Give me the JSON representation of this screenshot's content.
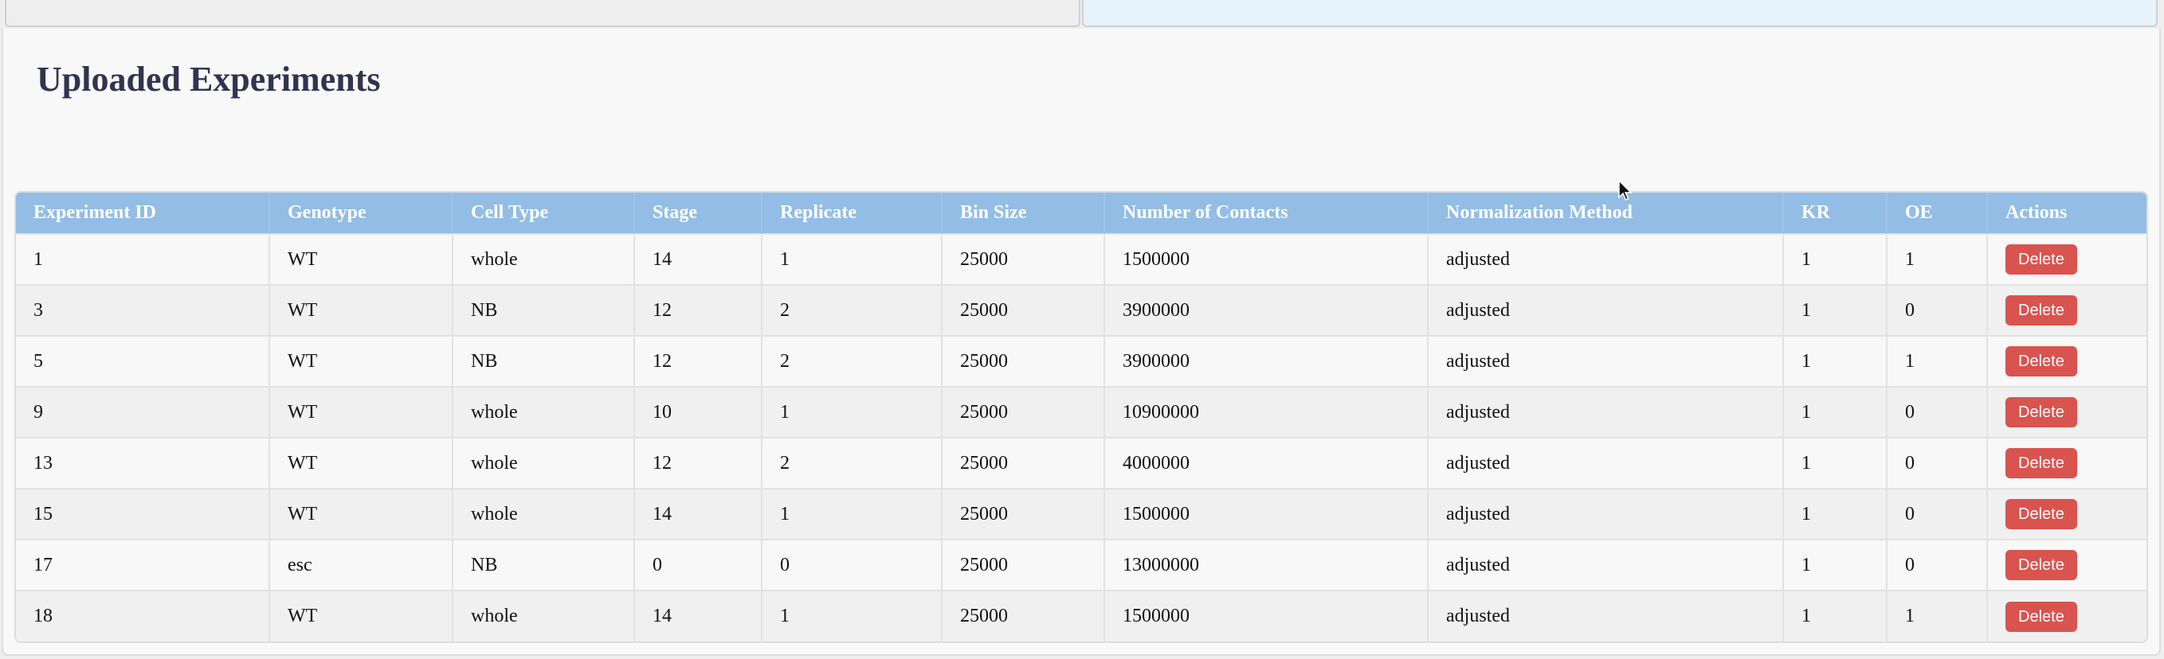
{
  "page": {
    "title": "Uploaded Experiments"
  },
  "table": {
    "headers": [
      "Experiment ID",
      "Genotype",
      "Cell Type",
      "Stage",
      "Replicate",
      "Bin Size",
      "Number of Contacts",
      "Normalization Method",
      "KR",
      "OE",
      "Actions"
    ],
    "rows": [
      [
        "1",
        "WT",
        "whole",
        "14",
        "1",
        "25000",
        "1500000",
        "adjusted",
        "1",
        "1"
      ],
      [
        "3",
        "WT",
        "NB",
        "12",
        "2",
        "25000",
        "3900000",
        "adjusted",
        "1",
        "0"
      ],
      [
        "5",
        "WT",
        "NB",
        "12",
        "2",
        "25000",
        "3900000",
        "adjusted",
        "1",
        "1"
      ],
      [
        "9",
        "WT",
        "whole",
        "10",
        "1",
        "25000",
        "10900000",
        "adjusted",
        "1",
        "0"
      ],
      [
        "13",
        "WT",
        "whole",
        "12",
        "2",
        "25000",
        "4000000",
        "adjusted",
        "1",
        "0"
      ],
      [
        "15",
        "WT",
        "whole",
        "14",
        "1",
        "25000",
        "1500000",
        "adjusted",
        "1",
        "0"
      ],
      [
        "17",
        "esc",
        "NB",
        "0",
        "0",
        "25000",
        "13000000",
        "adjusted",
        "1",
        "0"
      ],
      [
        "18",
        "WT",
        "whole",
        "14",
        "1",
        "25000",
        "1500000",
        "adjusted",
        "1",
        "1"
      ]
    ],
    "delete_label": "Delete"
  },
  "colors": {
    "header_bg": "#93bde4",
    "delete_button": "#d9534f",
    "title_text": "#333350",
    "right_panel_bg": "#e6f2fc"
  },
  "icons": {
    "cursor": "mouse-pointer-icon"
  }
}
